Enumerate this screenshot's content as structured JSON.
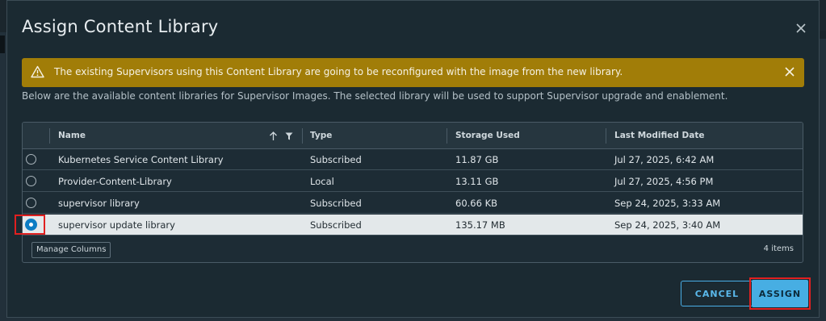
{
  "modal": {
    "title": "Assign Content Library"
  },
  "alert": {
    "message": "The existing Supervisors using this Content Library are going to be reconfigured with the image from the new library."
  },
  "description": "Below are the available content libraries for Supervisor Images. The selected library will be used to support Supervisor upgrade and enablement.",
  "table": {
    "columns": {
      "name": "Name",
      "type": "Type",
      "storage": "Storage Used",
      "modified": "Last Modified Date"
    },
    "rows": [
      {
        "name": "Kubernetes Service Content Library",
        "type": "Subscribed",
        "storage": "11.87 GB",
        "modified": "Jul 27, 2025, 6:42 AM",
        "selected": false
      },
      {
        "name": "Provider-Content-Library",
        "type": "Local",
        "storage": "13.11 GB",
        "modified": "Jul 27, 2025, 4:56 PM",
        "selected": false
      },
      {
        "name": "supervisor library",
        "type": "Subscribed",
        "storage": "60.66 KB",
        "modified": "Sep 24, 2025, 3:33 AM",
        "selected": false
      },
      {
        "name": "supervisor update library",
        "type": "Subscribed",
        "storage": "135.17 MB",
        "modified": "Sep 24, 2025, 3:40 AM",
        "selected": true
      }
    ],
    "manage_columns_label": "Manage Columns",
    "item_count": "4 items"
  },
  "buttons": {
    "cancel": "CANCEL",
    "assign": "ASSIGN"
  },
  "colors": {
    "alert_bg": "#a17d08",
    "primary": "#47aee3",
    "selected_row_bg": "#e3e8ea",
    "annotation_red": "#e02020"
  },
  "icons": {
    "warning": "warning-triangle-icon",
    "close": "close-icon",
    "sort": "sort-ascending-icon",
    "filter": "filter-icon"
  }
}
